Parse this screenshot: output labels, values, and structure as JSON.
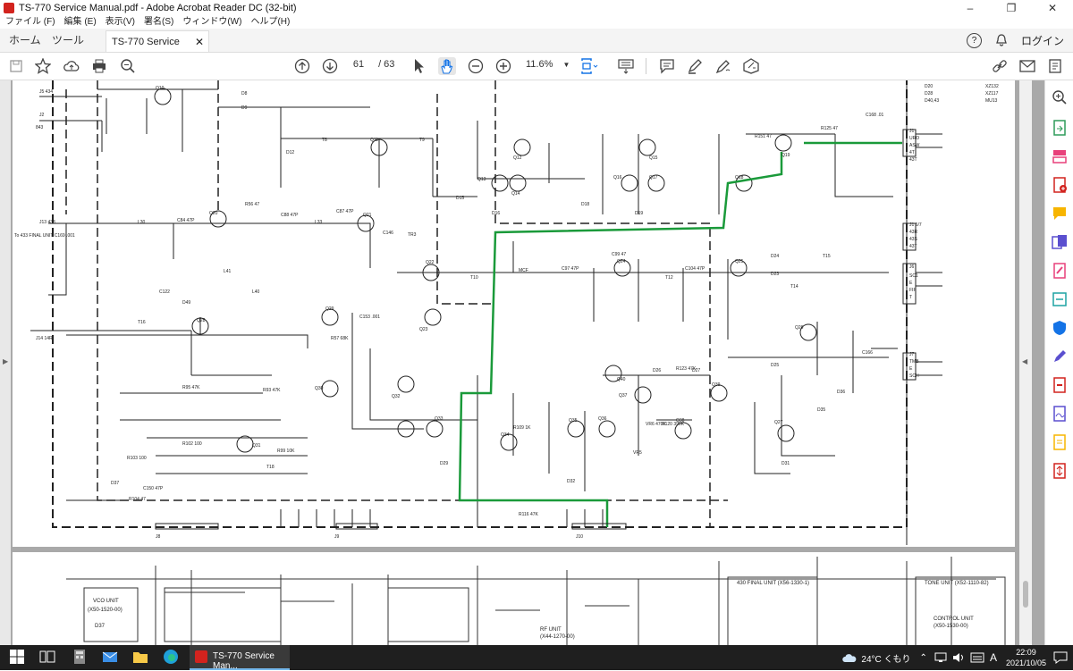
{
  "window": {
    "title": "TS-770 Service Manual.pdf - Adobe Acrobat Reader DC (32-bit)",
    "minimize_icon": "–",
    "restore_icon": "❐",
    "close_icon": "✕"
  },
  "menu": [
    "ファイル (F)",
    "編集 (E)",
    "表示(V)",
    "署名(S)",
    "ウィンドウ(W)",
    "ヘルプ(H)"
  ],
  "tabs": {
    "home": "ホーム",
    "tools": "ツール",
    "document": "TS-770 Service Man...",
    "close": "✕"
  },
  "header_right": {
    "help": "?",
    "login": "ログイン"
  },
  "toolbar": {
    "current_page": "61",
    "page_separator": "/ 63",
    "zoom": "11.6%"
  },
  "schematic": {
    "top_right_labels": [
      "D20",
      "D28",
      "D40,43",
      "XZ132",
      "XZ117",
      "MU13"
    ],
    "components": [
      "Q10",
      "Q11",
      "Q12",
      "Q13",
      "Q14",
      "Q15",
      "Q16",
      "Q17",
      "Q18",
      "Q19",
      "Q20",
      "Q21",
      "Q22",
      "Q23",
      "Q24",
      "Q25",
      "Q26",
      "Q27",
      "Q28",
      "Q29",
      "Q30",
      "Q31",
      "Q32",
      "Q33",
      "Q34",
      "Q35",
      "Q36",
      "Q37",
      "Q38",
      "Q39",
      "Q40",
      "D8",
      "D9",
      "D12",
      "D15",
      "D16",
      "D18",
      "D19",
      "D23",
      "D24",
      "D25",
      "D26",
      "D27",
      "D29",
      "D31",
      "D32",
      "D35",
      "D36",
      "D37",
      "D49",
      "L30",
      "L33",
      "L40",
      "L41",
      "T8",
      "T9",
      "T10",
      "T12",
      "T14",
      "T15",
      "T16",
      "T18",
      "TR3",
      "MCF",
      "R56 47",
      "R57 68K",
      "R93 47K",
      "R95 47K",
      "R99 10K",
      "R102 100",
      "R103 100",
      "R104 47",
      "R109 1K",
      "R116 47K",
      "R120 390K",
      "R123 47K",
      "R125 47",
      "R151 47",
      "C84 47P",
      "C87 47P",
      "C88 47P",
      "C97 47P",
      "C99 47",
      "C104 47P",
      "C122",
      "C146",
      "C150 47P",
      "C153 .001",
      "C166",
      "C168 .01",
      "VR5",
      "VR6 470K"
    ],
    "connector_labels": {
      "left": [
        "J5 434",
        "J2",
        "843",
        "J13 433",
        "J14 14R"
      ],
      "left_note": "To 433 FINAL UNIT C169 .001",
      "right": [
        "J1",
        "URO",
        "ASW",
        "4T",
        "43T",
        "J1 5/7",
        "43R",
        "43S",
        "43T",
        "J6",
        "SC1",
        "E",
        "FIF",
        "T",
        "J7",
        "TMB",
        "E",
        "SCH"
      ],
      "bottom": [
        "J8",
        "J9",
        "J10"
      ]
    },
    "lower_labels": {
      "vco": "VCO UNIT",
      "vco_part": "(X50-1520-00)",
      "d37": "D37",
      "rf": "RF UNIT",
      "rf_part": "(X44-1270-00)",
      "final": "430 FINAL UNIT (X56-1330-1)",
      "tone": "TONE UNIT (X52-1110-82)",
      "control": "CONTROL UNIT",
      "control_part": "(X50-1530-00)"
    }
  },
  "taskbar": {
    "active_app": "TS-770 Service Man...",
    "weather": "24°C くもり",
    "ime": "A",
    "time": "22:09",
    "date": "2021/10/05"
  },
  "colors": {
    "accent_green": "#1a9a3a",
    "acrobat_red": "#d2231e",
    "taskbar": "#1f1f1f"
  }
}
